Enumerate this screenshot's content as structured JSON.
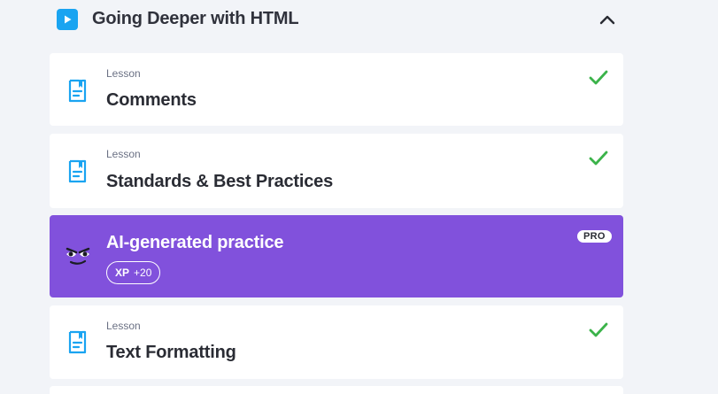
{
  "section": {
    "title": "Going Deeper with HTML",
    "play_icon": "play-icon",
    "collapse_icon": "chevron-up-icon"
  },
  "lessons": [
    {
      "kind": "Lesson",
      "title": "Comments",
      "completed": true
    },
    {
      "kind": "Lesson",
      "title": "Standards & Best Practices",
      "completed": true
    },
    {
      "kind": "Lesson",
      "title": "Text Formatting",
      "completed": true
    }
  ],
  "ai_practice": {
    "title": "AI-generated practice",
    "badge": "PRO",
    "xp_label": "XP",
    "xp_value": "+20"
  },
  "colors": {
    "accent_blue": "#1aa4f1",
    "ai_purple": "#8151dc",
    "check_green": "#3bb34a",
    "background": "#f2f4f8"
  }
}
